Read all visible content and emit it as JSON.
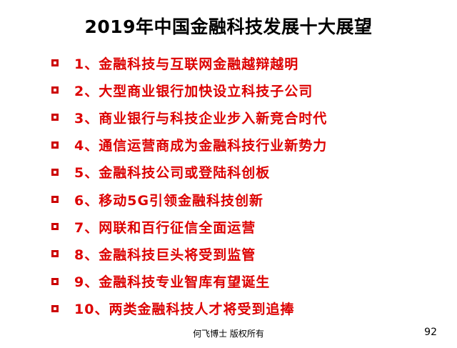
{
  "slide": {
    "title": "2019年中国金融科技发展十大展望",
    "items": [
      "1、金融科技与互联网金融越辩越明",
      "2、大型商业银行加快设立科技子公司",
      "3、商业银行与科技企业步入新竞合时代",
      "4、通信运营商成为金融科技行业新势力",
      "5、金融科技公司或登陆科创板",
      "6、移动5G引领金融科技创新",
      "7、网联和百行征信全面运营",
      "8、金融科技巨头将受到监管",
      "9、金融科技专业智库有望诞生",
      "10、两类金融科技人才将受到追捧"
    ],
    "footer": "何飞博士 版权所有",
    "page_number": "92"
  },
  "colors": {
    "bullet_text": "#dd0000",
    "bullet_marker": "#cc0000",
    "title": "#000000",
    "background": "#ffffff"
  },
  "icons": {
    "bullet": "hollow-square-icon"
  }
}
